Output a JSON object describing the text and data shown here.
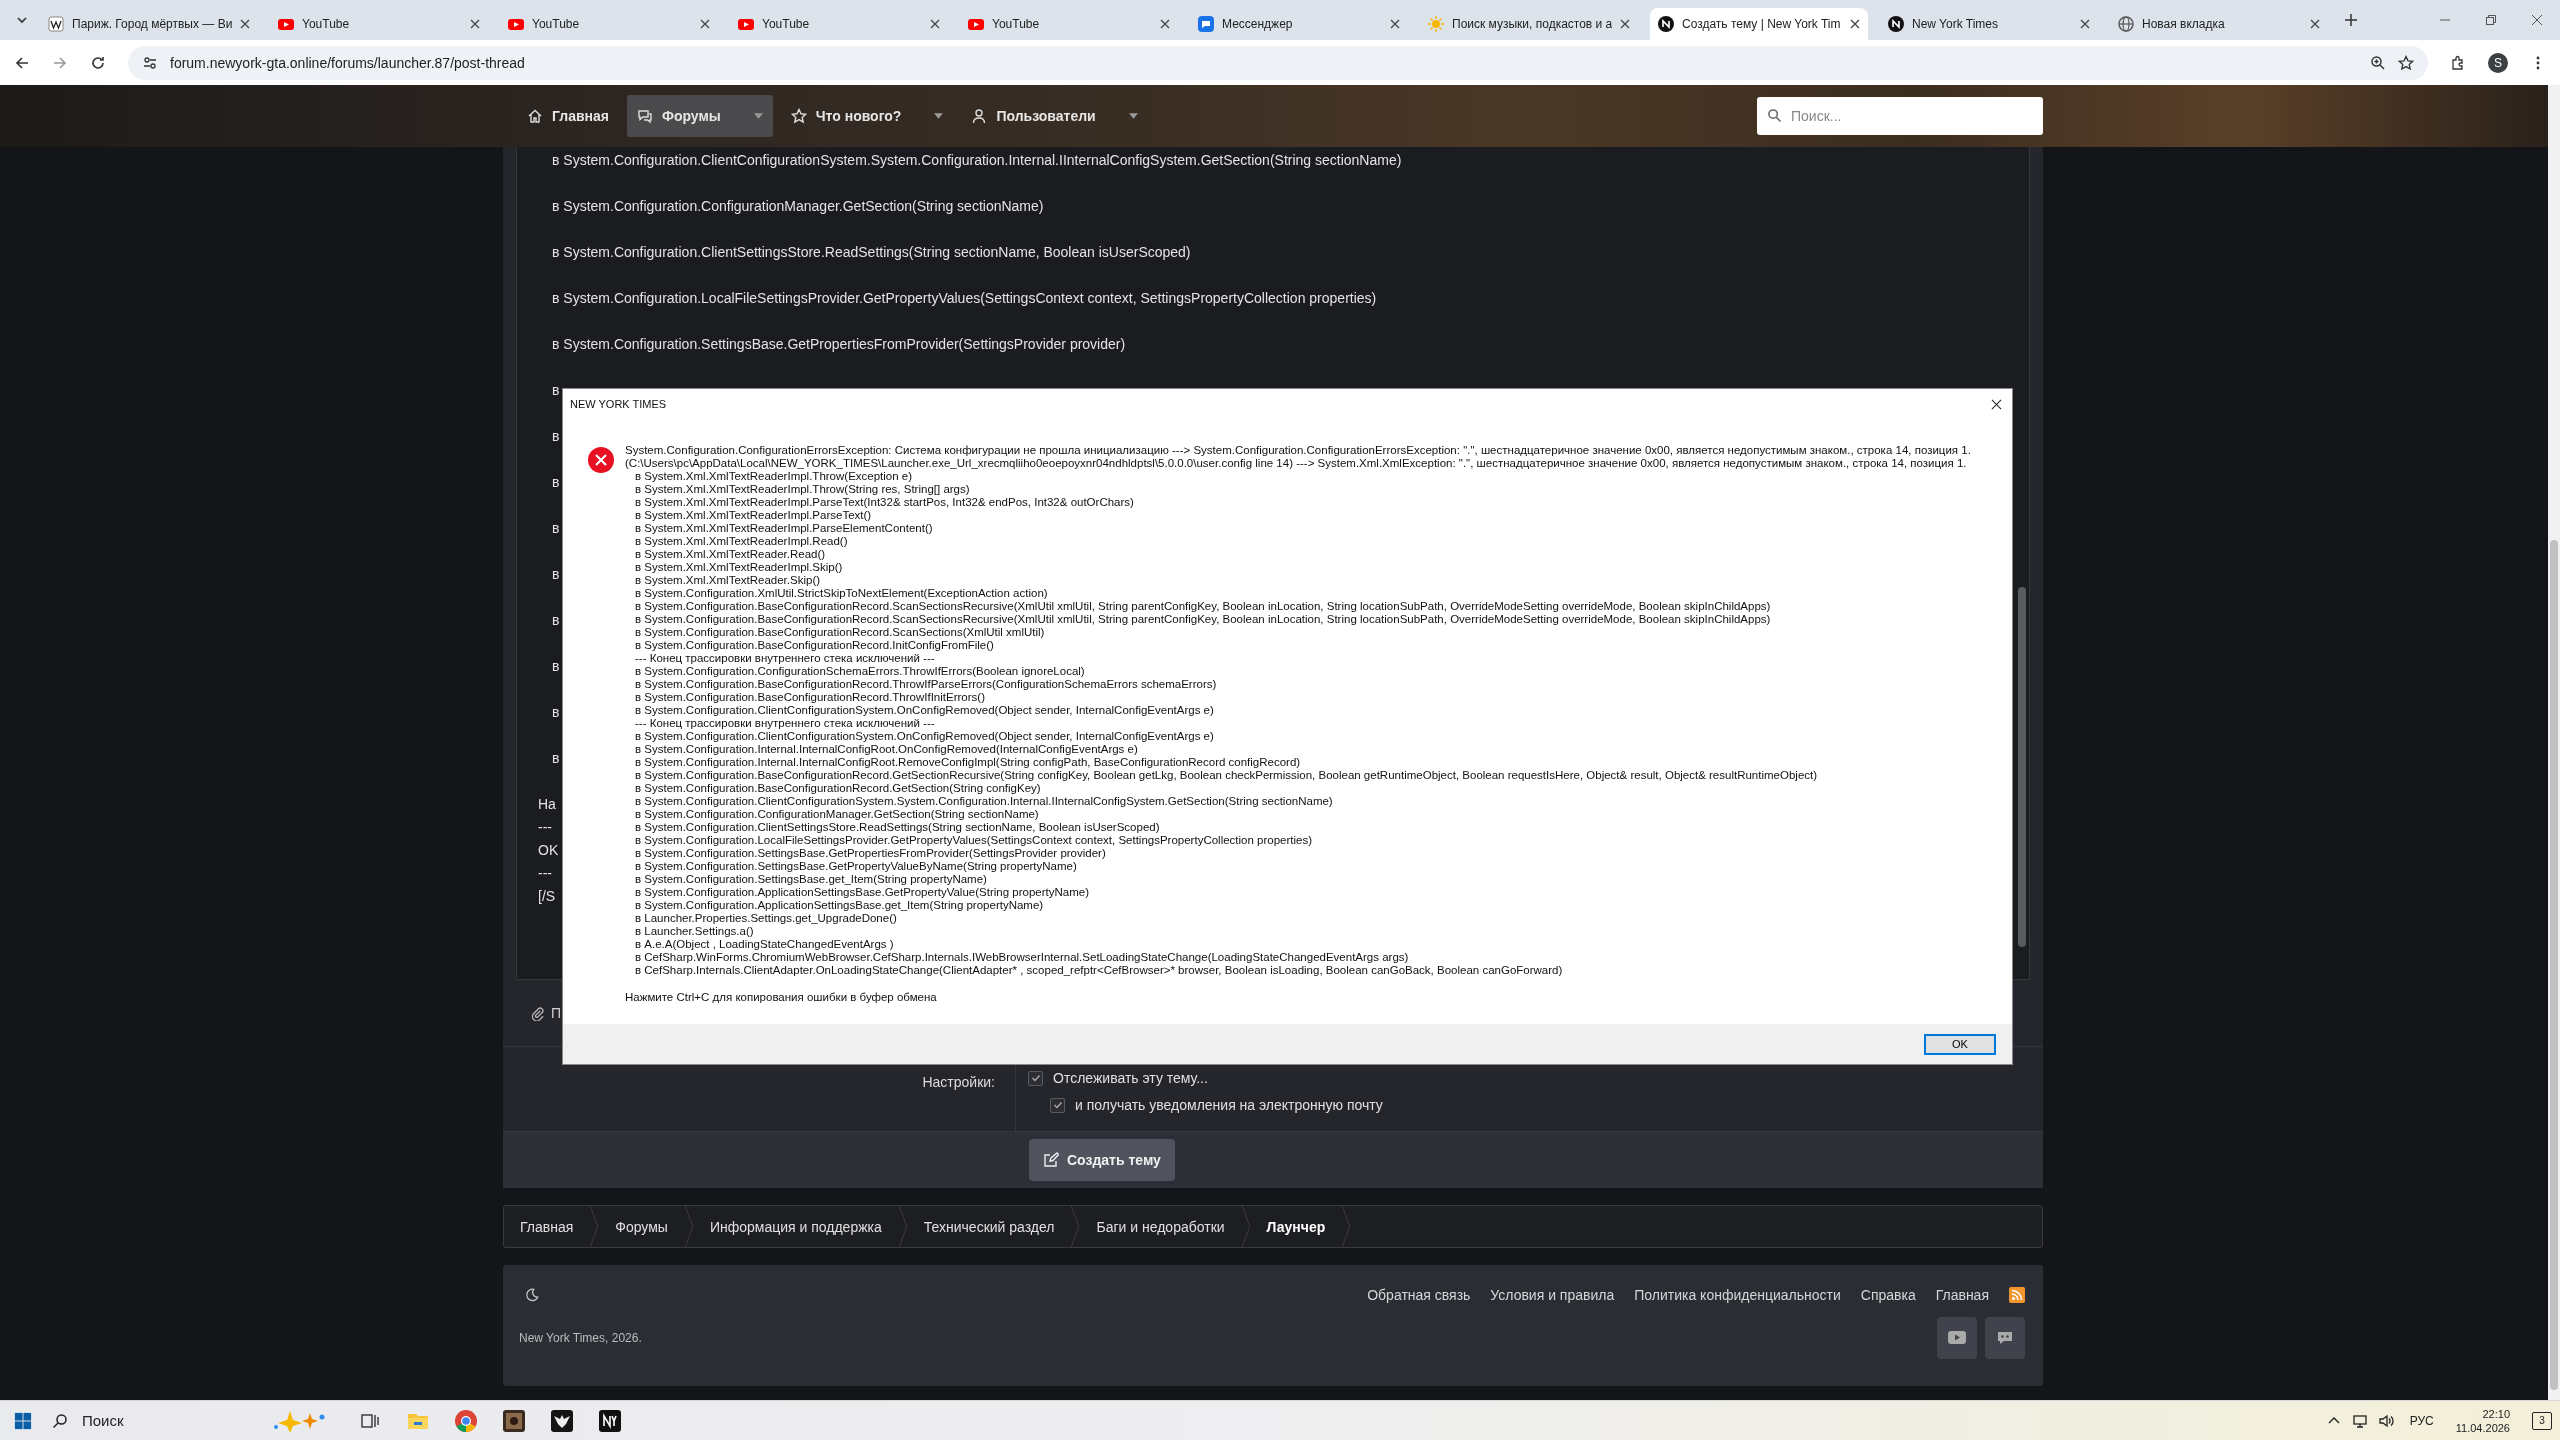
{
  "browser": {
    "tabs": [
      {
        "title": "Париж. Город мёртвых — Ви",
        "kind": "wiki",
        "selected": false
      },
      {
        "title": "YouTube",
        "kind": "youtube",
        "selected": false
      },
      {
        "title": "YouTube",
        "kind": "youtube",
        "selected": false
      },
      {
        "title": "YouTube",
        "kind": "youtube",
        "selected": false
      },
      {
        "title": "YouTube",
        "kind": "youtube",
        "selected": false
      },
      {
        "title": "Мессенджер",
        "kind": "messenger",
        "selected": false
      },
      {
        "title": "Поиск музыки, подкастов и а",
        "kind": "sun",
        "selected": false
      },
      {
        "title": "Создать тему | New York Tim",
        "kind": "nyt",
        "selected": true
      },
      {
        "title": "New York Times",
        "kind": "nyt",
        "selected": false
      },
      {
        "title": "Новая вкладка",
        "kind": "globe",
        "selected": false
      }
    ],
    "url": "forum.newyork-gta.online/forums/launcher.87/post-thread",
    "profile": "S"
  },
  "forum": {
    "nav": [
      {
        "label": "Главная",
        "kind": "home",
        "selected": false,
        "dropdown": false
      },
      {
        "label": "Форумы",
        "kind": "chat",
        "selected": true,
        "dropdown": true
      },
      {
        "label": "Что нового?",
        "kind": "star",
        "selected": false,
        "dropdown": true
      },
      {
        "label": "Пользователи",
        "kind": "user",
        "selected": false,
        "dropdown": true
      }
    ],
    "search": {
      "placeholder": "Поиск..."
    },
    "editor": {
      "trace_lines": [
        "в System.Configuration.ClientConfigurationSystem.System.Configuration.Internal.IInternalConfigSystem.GetSection(String sectionName)",
        "в System.Configuration.ConfigurationManager.GetSection(String sectionName)",
        "в System.Configuration.ClientSettingsStore.ReadSettings(String sectionName, Boolean isUserScoped)",
        "в System.Configuration.LocalFileSettingsProvider.GetPropertyValues(SettingsContext context, SettingsPropertyCollection properties)",
        "в System.Configuration.SettingsBase.GetPropertiesFromProvider(SettingsProvider provider)",
        "в",
        "в",
        "в",
        "в",
        "в",
        "в",
        "в",
        "в",
        "в"
      ],
      "tail_lines": [
        "На",
        "---",
        "OK",
        "---",
        "[/S"
      ]
    },
    "attach_label": "П",
    "settings": {
      "label": "Настройки:",
      "options": [
        {
          "label": "Отслеживать эту тему...",
          "checked": true,
          "children": [
            {
              "label": "и получать уведомления на электронную почту",
              "checked": true
            }
          ]
        }
      ]
    },
    "submit": "Создать тему",
    "breadcrumbs": [
      {
        "label": "Главная",
        "current": false
      },
      {
        "label": "Форумы",
        "current": false
      },
      {
        "label": "Информация и поддержка",
        "current": false
      },
      {
        "label": "Технический раздел",
        "current": false
      },
      {
        "label": "Баги и недоработки",
        "current": false
      },
      {
        "label": "Лаунчер",
        "current": true
      }
    ],
    "footer": {
      "links": [
        "Обратная связь",
        "Условия и правила",
        "Политика конфиденциальности",
        "Справка",
        "Главная"
      ],
      "copyright": "New York Times, 2026.",
      "socials": [
        {
          "kind": "youtube"
        },
        {
          "kind": "discord"
        }
      ]
    }
  },
  "dialog": {
    "title": "NEW YORK TIMES",
    "message": [
      "System.Configuration.ConfigurationErrorsException: Система конфигурации не прошла инициализацию ---> System.Configuration.ConfigurationErrorsException: \".\", шестнадцатеричное значение 0x00, является недопустимым знаком., строка 14, позиция 1.",
      "(C:\\Users\\pc\\AppData\\Local\\NEW_YORK_TIMES\\Launcher.exe_Url_xrecmqliiho0eoepoyxnr04ndhldptsl\\5.0.0.0\\user.config line 14) ---> System.Xml.XmlException: \".\", шестнадцатеричное значение 0x00, является недопустимым знаком., строка 14, позиция 1."
    ],
    "stack": [
      "в System.Xml.XmlTextReaderImpl.Throw(Exception e)",
      "в System.Xml.XmlTextReaderImpl.Throw(String res, String[] args)",
      "в System.Xml.XmlTextReaderImpl.ParseText(Int32& startPos, Int32& endPos, Int32& outOrChars)",
      "в System.Xml.XmlTextReaderImpl.ParseText()",
      "в System.Xml.XmlTextReaderImpl.ParseElementContent()",
      "в System.Xml.XmlTextReaderImpl.Read()",
      "в System.Xml.XmlTextReader.Read()",
      "в System.Xml.XmlTextReaderImpl.Skip()",
      "в System.Xml.XmlTextReader.Skip()",
      "в System.Configuration.XmlUtil.StrictSkipToNextElement(ExceptionAction action)",
      "в System.Configuration.BaseConfigurationRecord.ScanSectionsRecursive(XmlUtil xmlUtil, String parentConfigKey, Boolean inLocation, String locationSubPath, OverrideModeSetting overrideMode, Boolean skipInChildApps)",
      "в System.Configuration.BaseConfigurationRecord.ScanSectionsRecursive(XmlUtil xmlUtil, String parentConfigKey, Boolean inLocation, String locationSubPath, OverrideModeSetting overrideMode, Boolean skipInChildApps)",
      "в System.Configuration.BaseConfigurationRecord.ScanSections(XmlUtil xmlUtil)",
      "в System.Configuration.BaseConfigurationRecord.InitConfigFromFile()",
      "--- Конец трассировки внутреннего стека исключений ---",
      "в System.Configuration.ConfigurationSchemaErrors.ThrowIfErrors(Boolean ignoreLocal)",
      "в System.Configuration.BaseConfigurationRecord.ThrowIfParseErrors(ConfigurationSchemaErrors schemaErrors)",
      "в System.Configuration.BaseConfigurationRecord.ThrowIfInitErrors()",
      "в System.Configuration.ClientConfigurationSystem.OnConfigRemoved(Object sender, InternalConfigEventArgs e)",
      "--- Конец трассировки внутреннего стека исключений ---",
      "в System.Configuration.ClientConfigurationSystem.OnConfigRemoved(Object sender, InternalConfigEventArgs e)",
      "в System.Configuration.Internal.InternalConfigRoot.OnConfigRemoved(InternalConfigEventArgs e)",
      "в System.Configuration.Internal.InternalConfigRoot.RemoveConfigImpl(String configPath, BaseConfigurationRecord configRecord)",
      "в System.Configuration.BaseConfigurationRecord.GetSectionRecursive(String configKey, Boolean getLkg, Boolean checkPermission, Boolean getRuntimeObject, Boolean requestIsHere, Object& result, Object& resultRuntimeObject)",
      "в System.Configuration.BaseConfigurationRecord.GetSection(String configKey)",
      "в System.Configuration.ClientConfigurationSystem.System.Configuration.Internal.IInternalConfigSystem.GetSection(String sectionName)",
      "в System.Configuration.ConfigurationManager.GetSection(String sectionName)",
      "в System.Configuration.ClientSettingsStore.ReadSettings(String sectionName, Boolean isUserScoped)",
      "в System.Configuration.LocalFileSettingsProvider.GetPropertyValues(SettingsContext context, SettingsPropertyCollection properties)",
      "в System.Configuration.SettingsBase.GetPropertiesFromProvider(SettingsProvider provider)",
      "в System.Configuration.SettingsBase.GetPropertyValueByName(String propertyName)",
      "в System.Configuration.SettingsBase.get_Item(String propertyName)",
      "в System.Configuration.ApplicationSettingsBase.GetPropertyValue(String propertyName)",
      "в System.Configuration.ApplicationSettingsBase.get_Item(String propertyName)",
      "в Launcher.Properties.Settings.get_UpgradeDone()",
      "в Launcher.Settings.a()",
      "в A.e.A(Object , LoadingStateChangedEventArgs )",
      "в CefSharp.WinForms.ChromiumWebBrowser.CefSharp.Internals.IWebBrowserInternal.SetLoadingStateChange(LoadingStateChangedEventArgs args)",
      "в CefSharp.Internals.ClientAdapter.OnLoadingStateChange(ClientAdapter* , scoped_refptr<CefBrowser>* browser, Boolean isLoading, Boolean canGoBack, Boolean canGoForward)"
    ],
    "hint": "Нажмите Ctrl+C для копирования ошибки в буфер обмена",
    "ok": "OK"
  },
  "taskbar": {
    "search": {
      "placeholder": "Поиск"
    },
    "apps": [
      {
        "kind": "taskview"
      },
      {
        "kind": "explorer"
      },
      {
        "kind": "chrome"
      },
      {
        "kind": "game"
      },
      {
        "kind": "bird"
      },
      {
        "kind": "nyt"
      }
    ],
    "language": "РУС",
    "time": "22:10",
    "date": "11.04.2026",
    "notifications": "3"
  }
}
